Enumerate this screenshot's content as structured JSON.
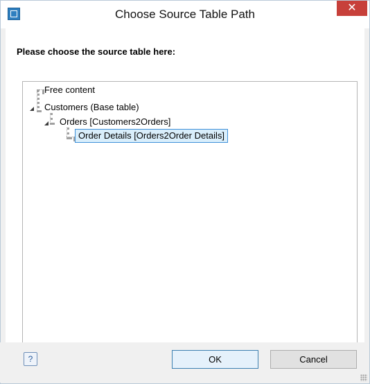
{
  "window": {
    "title": "Choose Source Table Path",
    "close_glyph": "✕"
  },
  "prompt": "Please choose the source table here:",
  "tree": {
    "items": [
      {
        "label": "Free content",
        "level": 0,
        "expanded": null
      },
      {
        "label": "Customers (Base table)",
        "level": 0,
        "expanded": true
      },
      {
        "label": "Orders [Customers2Orders]",
        "level": 1,
        "expanded": true
      },
      {
        "label": "Order Details [Orders2Order Details]",
        "level": 2,
        "expanded": null,
        "selected": true
      }
    ]
  },
  "buttons": {
    "help_glyph": "?",
    "ok": "OK",
    "cancel": "Cancel"
  },
  "colors": {
    "close": "#c7403a",
    "selection_bg": "#d9eefb",
    "selection_border": "#3d8fd9"
  }
}
